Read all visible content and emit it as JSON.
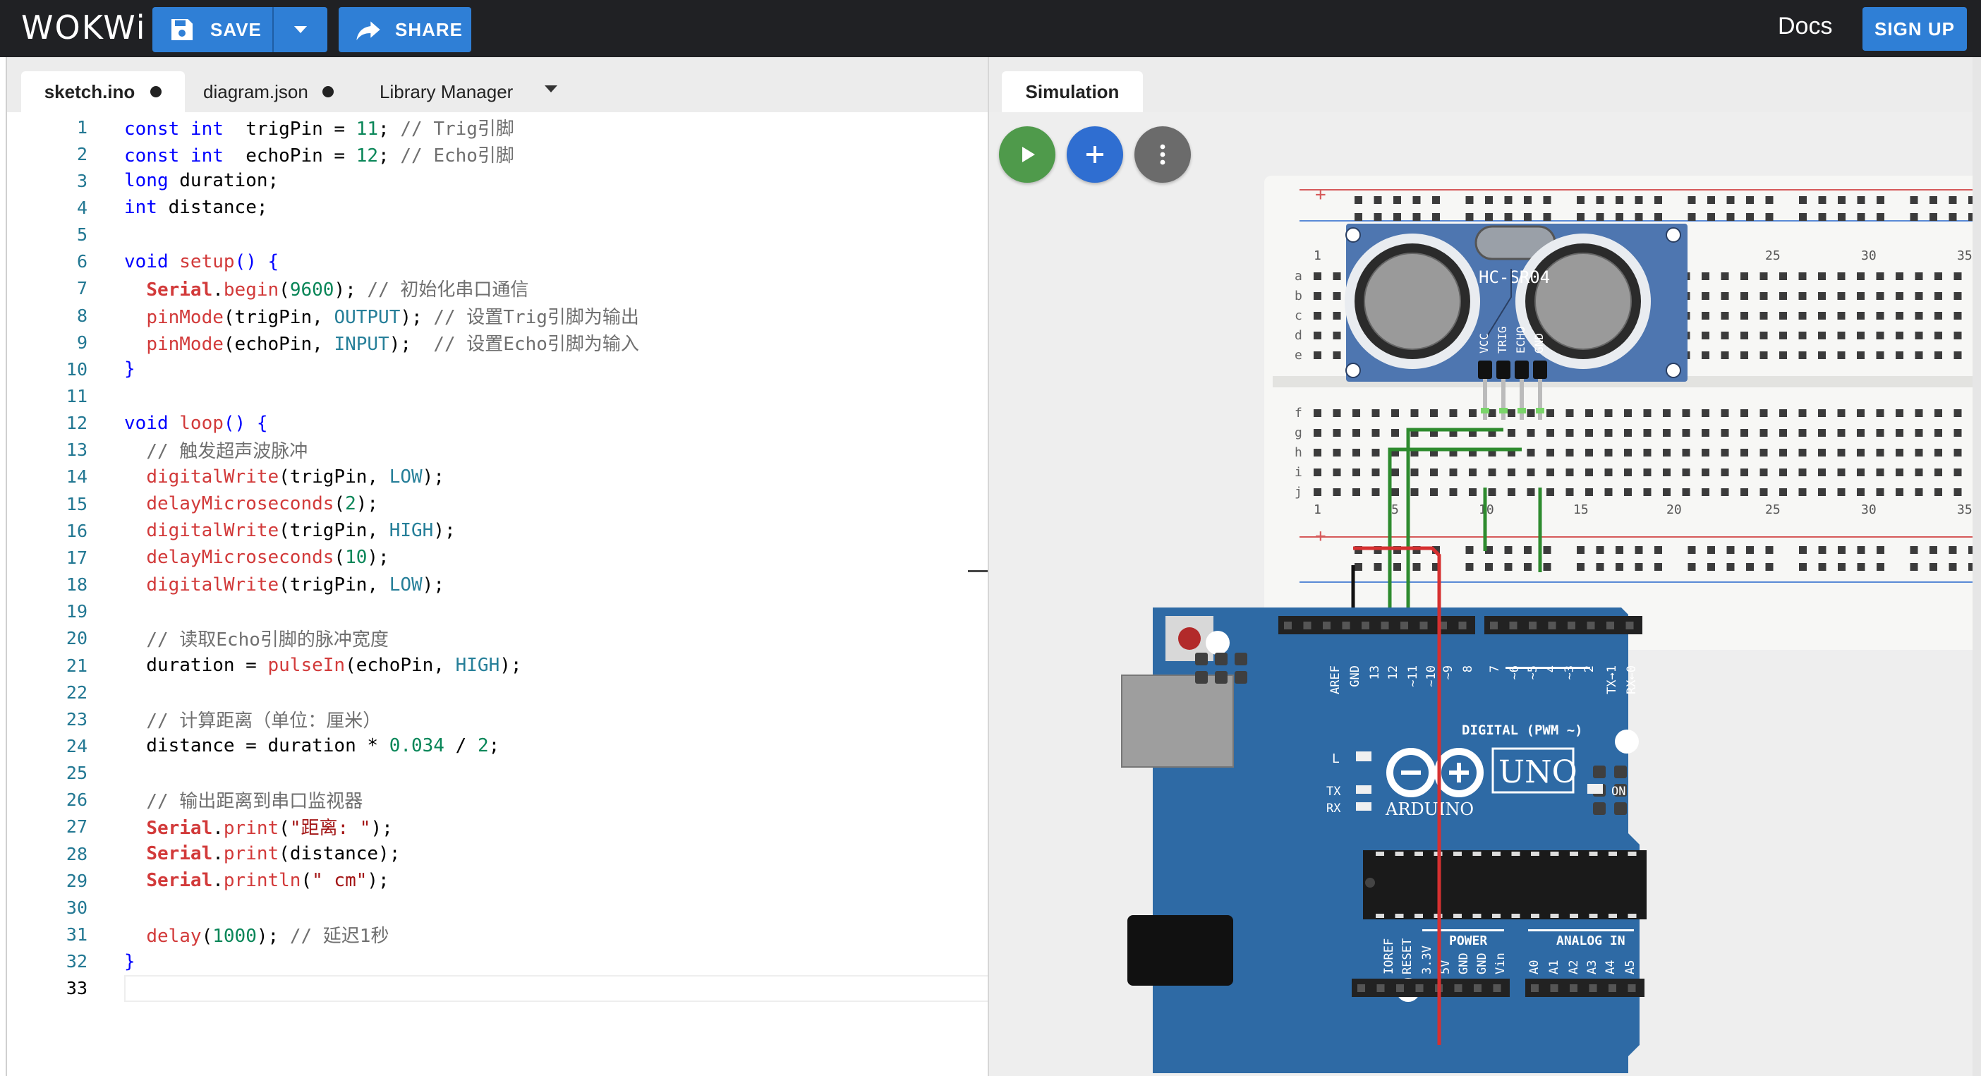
{
  "header": {
    "logo_text": "WOKWi",
    "save_label": "SAVE",
    "share_label": "SHARE",
    "docs_label": "Docs",
    "signup_label": "SIGN UP"
  },
  "editor": {
    "tabs": [
      {
        "label": "sketch.ino",
        "modified": true
      },
      {
        "label": "diagram.json",
        "modified": true
      },
      {
        "label": "Library Manager"
      }
    ],
    "lines": [
      {
        "n": "1",
        "tokens": [
          [
            "kw",
            "const "
          ],
          [
            "kw",
            "int"
          ],
          [
            "",
            "  trigPin = "
          ],
          [
            "num",
            "11"
          ],
          [
            "",
            "; "
          ],
          [
            "com",
            "// Trig引脚"
          ]
        ]
      },
      {
        "n": "2",
        "tokens": [
          [
            "kw",
            "const "
          ],
          [
            "kw",
            "int"
          ],
          [
            "",
            "  echoPin = "
          ],
          [
            "num",
            "12"
          ],
          [
            "",
            "; "
          ],
          [
            "com",
            "// Echo引脚"
          ]
        ]
      },
      {
        "n": "3",
        "tokens": [
          [
            "kw",
            "long"
          ],
          [
            "",
            " duration;"
          ]
        ]
      },
      {
        "n": "4",
        "tokens": [
          [
            "kw",
            "int"
          ],
          [
            "",
            " distance;"
          ]
        ]
      },
      {
        "n": "5",
        "tokens": []
      },
      {
        "n": "6",
        "tokens": [
          [
            "kw",
            "void"
          ],
          [
            "",
            " "
          ],
          [
            "fn",
            "setup"
          ],
          [
            "kw",
            "() {"
          ]
        ]
      },
      {
        "n": "7",
        "tokens": [
          [
            "",
            "  "
          ],
          [
            "obj",
            "Serial"
          ],
          [
            "",
            "."
          ],
          [
            "fn",
            "begin"
          ],
          [
            "",
            "("
          ],
          [
            "num",
            "9600"
          ],
          [
            "",
            "); "
          ],
          [
            "com",
            "// 初始化串口通信"
          ]
        ]
      },
      {
        "n": "8",
        "tokens": [
          [
            "",
            "  "
          ],
          [
            "fn",
            "pinMode"
          ],
          [
            "",
            "(trigPin, "
          ],
          [
            "const",
            "OUTPUT"
          ],
          [
            "",
            "); "
          ],
          [
            "com",
            "// 设置Trig引脚为输出"
          ]
        ]
      },
      {
        "n": "9",
        "tokens": [
          [
            "",
            "  "
          ],
          [
            "fn",
            "pinMode"
          ],
          [
            "",
            "(echoPin, "
          ],
          [
            "const",
            "INPUT"
          ],
          [
            "",
            ");  "
          ],
          [
            "com",
            "// 设置Echo引脚为输入"
          ]
        ]
      },
      {
        "n": "10",
        "tokens": [
          [
            "kw",
            "}"
          ]
        ]
      },
      {
        "n": "11",
        "tokens": []
      },
      {
        "n": "12",
        "tokens": [
          [
            "kw",
            "void"
          ],
          [
            "",
            " "
          ],
          [
            "fn",
            "loop"
          ],
          [
            "kw",
            "() {"
          ]
        ]
      },
      {
        "n": "13",
        "tokens": [
          [
            "",
            "  "
          ],
          [
            "com",
            "// 触发超声波脉冲"
          ]
        ]
      },
      {
        "n": "14",
        "tokens": [
          [
            "",
            "  "
          ],
          [
            "fn",
            "digitalWrite"
          ],
          [
            "",
            "(trigPin, "
          ],
          [
            "const",
            "LOW"
          ],
          [
            "",
            ");"
          ]
        ]
      },
      {
        "n": "15",
        "tokens": [
          [
            "",
            "  "
          ],
          [
            "fn",
            "delayMicroseconds"
          ],
          [
            "",
            "("
          ],
          [
            "num",
            "2"
          ],
          [
            "",
            ");"
          ]
        ]
      },
      {
        "n": "16",
        "tokens": [
          [
            "",
            "  "
          ],
          [
            "fn",
            "digitalWrite"
          ],
          [
            "",
            "(trigPin, "
          ],
          [
            "const",
            "HIGH"
          ],
          [
            "",
            ");"
          ]
        ]
      },
      {
        "n": "17",
        "tokens": [
          [
            "",
            "  "
          ],
          [
            "fn",
            "delayMicroseconds"
          ],
          [
            "",
            "("
          ],
          [
            "num",
            "10"
          ],
          [
            "",
            ");"
          ]
        ]
      },
      {
        "n": "18",
        "tokens": [
          [
            "",
            "  "
          ],
          [
            "fn",
            "digitalWrite"
          ],
          [
            "",
            "(trigPin, "
          ],
          [
            "const",
            "LOW"
          ],
          [
            "",
            ");"
          ]
        ]
      },
      {
        "n": "19",
        "tokens": []
      },
      {
        "n": "20",
        "tokens": [
          [
            "",
            "  "
          ],
          [
            "com",
            "// 读取Echo引脚的脉冲宽度"
          ]
        ]
      },
      {
        "n": "21",
        "tokens": [
          [
            "",
            "  duration = "
          ],
          [
            "fn",
            "pulseIn"
          ],
          [
            "",
            "(echoPin, "
          ],
          [
            "const",
            "HIGH"
          ],
          [
            "",
            ");"
          ]
        ]
      },
      {
        "n": "22",
        "tokens": []
      },
      {
        "n": "23",
        "tokens": [
          [
            "",
            "  "
          ],
          [
            "com",
            "// 计算距离（单位：厘米）"
          ]
        ]
      },
      {
        "n": "24",
        "tokens": [
          [
            "",
            "  distance = duration * "
          ],
          [
            "num",
            "0.034"
          ],
          [
            "",
            " / "
          ],
          [
            "num",
            "2"
          ],
          [
            "",
            ";"
          ]
        ]
      },
      {
        "n": "25",
        "tokens": []
      },
      {
        "n": "26",
        "tokens": [
          [
            "",
            "  "
          ],
          [
            "com",
            "// 输出距离到串口监视器"
          ]
        ]
      },
      {
        "n": "27",
        "tokens": [
          [
            "",
            "  "
          ],
          [
            "obj",
            "Serial"
          ],
          [
            "",
            "."
          ],
          [
            "fn",
            "print"
          ],
          [
            "",
            "("
          ],
          [
            "str",
            "\"距离: \""
          ],
          [
            "",
            ");"
          ]
        ]
      },
      {
        "n": "28",
        "tokens": [
          [
            "",
            "  "
          ],
          [
            "obj",
            "Serial"
          ],
          [
            "",
            "."
          ],
          [
            "fn",
            "print"
          ],
          [
            "",
            "(distance);"
          ]
        ]
      },
      {
        "n": "29",
        "tokens": [
          [
            "",
            "  "
          ],
          [
            "obj",
            "Serial"
          ],
          [
            "",
            "."
          ],
          [
            "fn",
            "println"
          ],
          [
            "",
            "("
          ],
          [
            "str",
            "\" cm\""
          ],
          [
            "",
            ");"
          ]
        ]
      },
      {
        "n": "30",
        "tokens": []
      },
      {
        "n": "31",
        "tokens": [
          [
            "",
            "  "
          ],
          [
            "fn",
            "delay"
          ],
          [
            "",
            "("
          ],
          [
            "num",
            "1000"
          ],
          [
            "",
            "); "
          ],
          [
            "com",
            "// 延迟1秒"
          ]
        ]
      },
      {
        "n": "32",
        "tokens": [
          [
            "kw",
            "}"
          ]
        ]
      },
      {
        "n": "33",
        "tokens": []
      }
    ]
  },
  "simulation": {
    "tab_label": "Simulation",
    "breadboard": {
      "row_labels_top": [
        "a",
        "b",
        "c",
        "d",
        "e"
      ],
      "row_labels_bottom": [
        "f",
        "g",
        "h",
        "i",
        "j"
      ],
      "column_numbers_top": [
        "1",
        "25",
        "30",
        "35"
      ],
      "column_numbers_bottom": [
        "1",
        "5",
        "10",
        "15",
        "20",
        "25",
        "30",
        "35"
      ],
      "rail_plus": "+"
    },
    "sensor": {
      "label": "HC-SR04",
      "pins": [
        "VCC",
        "TRIG",
        "ECHO",
        "GND"
      ]
    },
    "arduino": {
      "brand": "ARDUINO",
      "model": "UNO",
      "digital_label": "DIGITAL (PWM ~)",
      "power_label": "POWER",
      "analog_label": "ANALOG IN",
      "on_label": "ON",
      "l_label": "L",
      "tx_label": "TX",
      "rx_label": "RX",
      "digital_pins": [
        "AREF",
        "GND",
        "13",
        "12",
        "~11",
        "~10",
        "~9",
        "8",
        "7",
        "~6",
        "~5",
        "4",
        "~3",
        "2",
        "TX→1",
        "RX←0"
      ],
      "power_pins": [
        "IOREF",
        "RESET",
        "3.3V",
        "5V",
        "GND",
        "GND",
        "Vin"
      ],
      "analog_pins": [
        "A0",
        "A1",
        "A2",
        "A3",
        "A4",
        "A5"
      ]
    },
    "colors": {
      "board": "#2e6aa5",
      "wire_green": "#2e8b2e",
      "wire_red": "#d63030",
      "wire_black": "#111111",
      "sensor": "#4e76b0"
    }
  }
}
